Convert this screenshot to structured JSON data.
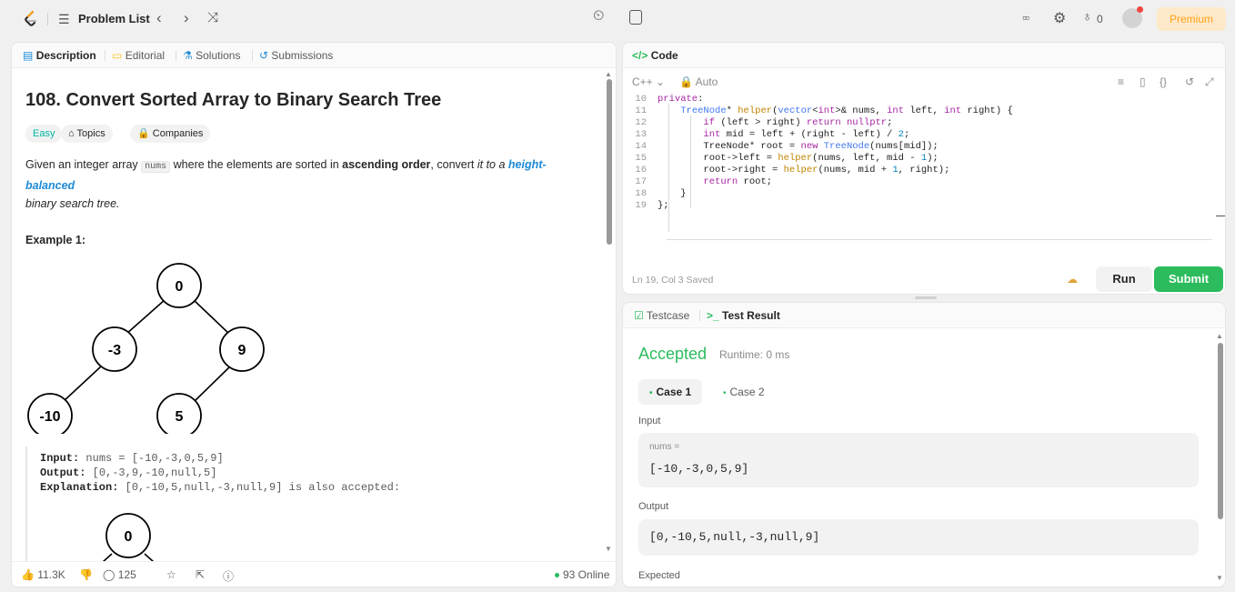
{
  "topbar": {
    "title": "Problem List",
    "fire_count": "0",
    "premium_label": "Premium",
    "icons": [
      "leetcode-logo",
      "list-icon",
      "chevron-left-icon",
      "chevron-right-icon",
      "shuffle-icon",
      "timer-icon",
      "notes-icon",
      "grid-icon",
      "gear-icon",
      "fire-icon",
      "avatar"
    ]
  },
  "left": {
    "tabs": [
      {
        "label": "Description",
        "icon": "description-icon"
      },
      {
        "label": "Editorial",
        "icon": "book-icon"
      },
      {
        "label": "Solutions",
        "icon": "flask-icon"
      },
      {
        "label": "Submissions",
        "icon": "history-icon"
      }
    ],
    "problem_title": "108. Convert Sorted Array to Binary Search Tree",
    "difficulty": "Easy",
    "chips": {
      "topics": "Topics",
      "companies": "Companies"
    },
    "description": {
      "part1": "Given an integer array ",
      "code": "nums",
      "part2": " where the elements are sorted in ",
      "bold": "ascending order",
      "part3": ", convert ",
      "em1": "it to a ",
      "highlight": "height-balanced",
      "em2": "binary search tree."
    },
    "example_title": "Example 1:",
    "tree1": {
      "root": "0",
      "left": "-3",
      "right": "9",
      "left_left": "-10",
      "right_left": "5"
    },
    "input_label": "Input:",
    "input_value": "nums = [-10,-3,0,5,9]",
    "output_label": "Output:",
    "output_value": "[0,-3,9,-10,null,5]",
    "explanation_label": "Explanation:",
    "explanation_value": "[0,-10,5,null,-3,null,9] is also accepted:",
    "tree2": {
      "root": "0"
    },
    "footer": {
      "likes": "11.3K",
      "comments": "125",
      "online": "93 Online"
    }
  },
  "code": {
    "header": "Code",
    "language": "C++",
    "mode": "Auto",
    "lines": [
      {
        "n": "10",
        "t": [
          [
            "kw",
            "private"
          ],
          [
            "p",
            ":"
          ]
        ]
      },
      {
        "n": "11",
        "t": [
          [
            "p",
            "    "
          ],
          [
            "ty",
            "TreeNode"
          ],
          [
            "p",
            "* "
          ],
          [
            "fn",
            "helper"
          ],
          [
            "p",
            "("
          ],
          [
            "ty",
            "vector"
          ],
          [
            "p",
            "<"
          ],
          [
            "kw",
            "int"
          ],
          [
            "p",
            ">& nums, "
          ],
          [
            "kw",
            "int"
          ],
          [
            "p",
            " left, "
          ],
          [
            "kw",
            "int"
          ],
          [
            "p",
            " right) {"
          ]
        ]
      },
      {
        "n": "12",
        "t": [
          [
            "p",
            "        "
          ],
          [
            "kw",
            "if"
          ],
          [
            "p",
            " (left > right) "
          ],
          [
            "kw",
            "return"
          ],
          [
            "p",
            " "
          ],
          [
            "kw",
            "nullptr"
          ],
          [
            "p",
            ";"
          ]
        ]
      },
      {
        "n": "13",
        "t": [
          [
            "p",
            "        "
          ],
          [
            "kw",
            "int"
          ],
          [
            "p",
            " mid = left + (right - left) / "
          ],
          [
            "num",
            "2"
          ],
          [
            "p",
            ";"
          ]
        ]
      },
      {
        "n": "14",
        "t": [
          [
            "p",
            "        TreeNode* root = "
          ],
          [
            "kw",
            "new"
          ],
          [
            "p",
            " "
          ],
          [
            "ty",
            "TreeNode"
          ],
          [
            "p",
            "(nums[mid]);"
          ]
        ]
      },
      {
        "n": "15",
        "t": [
          [
            "p",
            "        root->left = "
          ],
          [
            "fn",
            "helper"
          ],
          [
            "p",
            "(nums, left, mid - "
          ],
          [
            "num",
            "1"
          ],
          [
            "p",
            ");"
          ]
        ]
      },
      {
        "n": "16",
        "t": [
          [
            "p",
            "        root->right = "
          ],
          [
            "fn",
            "helper"
          ],
          [
            "p",
            "(nums, mid + "
          ],
          [
            "num",
            "1"
          ],
          [
            "p",
            ", right);"
          ]
        ]
      },
      {
        "n": "17",
        "t": [
          [
            "p",
            "        "
          ],
          [
            "kw",
            "return"
          ],
          [
            "p",
            " root;"
          ]
        ]
      },
      {
        "n": "18",
        "t": [
          [
            "p",
            "    }"
          ]
        ]
      },
      {
        "n": "19",
        "t": [
          [
            "p",
            "};"
          ]
        ]
      }
    ],
    "status": "Ln 19, Col 3   Saved",
    "run_label": "Run",
    "submit_label": "Submit"
  },
  "result": {
    "tabs": [
      {
        "label": "Testcase"
      },
      {
        "label": "Test Result"
      }
    ],
    "verdict": "Accepted",
    "runtime": "Runtime: 0 ms",
    "cases": [
      "Case 1",
      "Case 2"
    ],
    "input_label": "Input",
    "input_key": "nums =",
    "input_value": "[-10,-3,0,5,9]",
    "output_label": "Output",
    "output_value": "[0,-10,5,null,-3,null,9]",
    "expected_label": "Expected"
  },
  "colors": {
    "accent_green": "#2cbb5d",
    "easy": "#00b8a3",
    "premium": "#ffa116",
    "link_blue": "#1d8ad6"
  }
}
